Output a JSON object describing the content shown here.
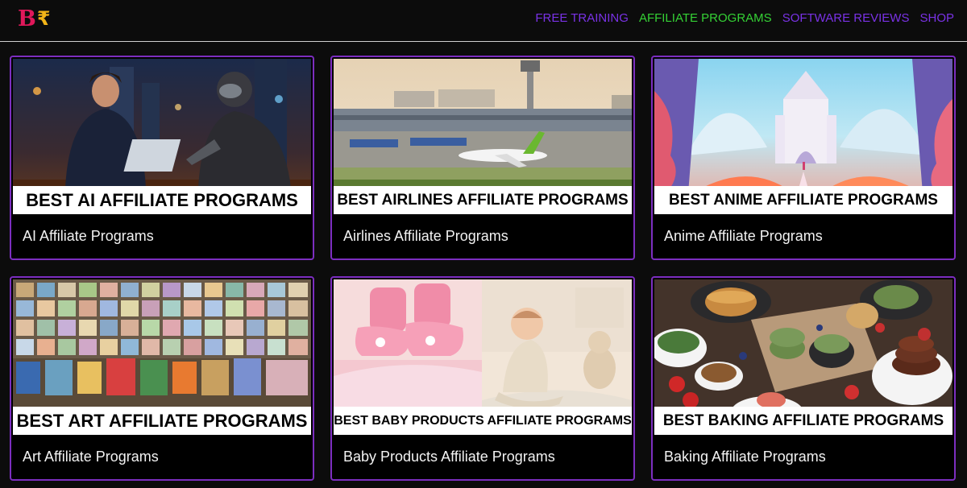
{
  "logo": {
    "letter": "B",
    "symbol": "₹"
  },
  "nav": [
    {
      "label": "FREE TRAINING",
      "color": "#7a32e6"
    },
    {
      "label": "AFFILIATE PROGRAMS",
      "color": "#35d135"
    },
    {
      "label": "SOFTWARE REVIEWS",
      "color": "#7a32e6"
    },
    {
      "label": "SHOP",
      "color": "#7a32e6"
    }
  ],
  "cards": [
    {
      "banner": "BEST AI AFFILIATE PROGRAMS",
      "title": "AI Affiliate Programs",
      "image": "ai-robot-laptop-image"
    },
    {
      "banner": "BEST AIRLINES AFFILIATE PROGRAMS",
      "title": "Airlines Affiliate Programs",
      "image": "airport-plane-image"
    },
    {
      "banner": "BEST ANIME AFFILIATE PROGRAMS",
      "title": "Anime Affiliate Programs",
      "image": "anime-castle-landscape-image"
    },
    {
      "banner": "BEST ART AFFILIATE PROGRAMS",
      "title": "Art Affiliate Programs",
      "image": "art-paintings-wall-image"
    },
    {
      "banner": "BEST BABY PRODUCTS AFFILIATE PROGRAMS",
      "title": "Baby Products Affiliate Programs",
      "image": "baby-shoes-infant-image"
    },
    {
      "banner": "BEST BAKING AFFILIATE PROGRAMS",
      "title": "Baking Affiliate Programs",
      "image": "pancakes-baking-image"
    }
  ],
  "colors": {
    "accent": "#7c2ec0",
    "background": "#0c0c0c",
    "nav_active": "#35d135"
  }
}
